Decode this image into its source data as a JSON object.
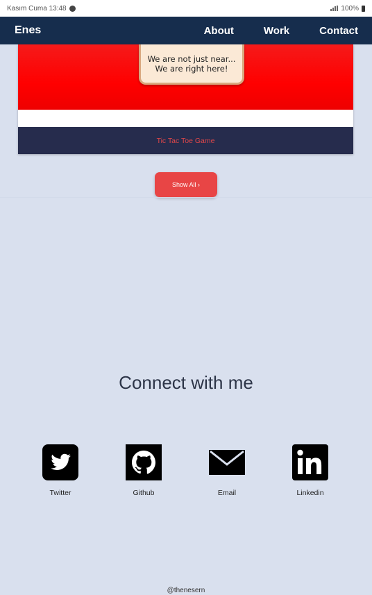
{
  "status_bar": {
    "left_text": "Kasım Cuma 13:48",
    "right_text": "100%"
  },
  "navbar": {
    "brand": "Enes",
    "links": [
      {
        "label": "About"
      },
      {
        "label": "Work"
      },
      {
        "label": "Contact"
      }
    ]
  },
  "project_card": {
    "sign_line1": "We are not just near...",
    "sign_line2": "We are right here!",
    "title": "Tic Tac Toe Game",
    "image_color": "#ff0000",
    "footer_color": "#262c4d",
    "title_color": "#e0474a"
  },
  "show_all_button": {
    "label": "Show All ›",
    "color": "#e84545"
  },
  "connect": {
    "title": "Connect with me",
    "links": [
      {
        "label": "Twitter",
        "icon": "twitter-icon"
      },
      {
        "label": "Github",
        "icon": "github-icon"
      },
      {
        "label": "Email",
        "icon": "email-icon"
      },
      {
        "label": "Linkedin",
        "icon": "linkedin-icon"
      }
    ]
  },
  "footer": {
    "credit": "@thenesern"
  }
}
